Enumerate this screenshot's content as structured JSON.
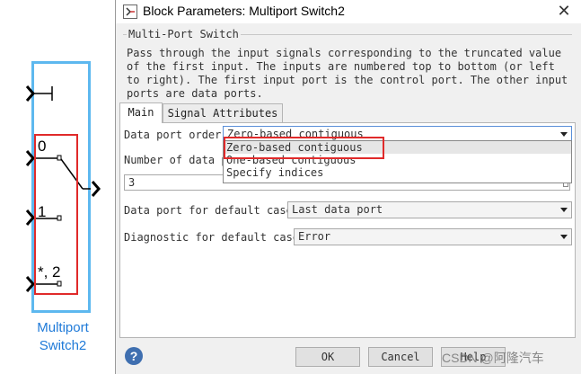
{
  "block": {
    "port_labels": [
      "0",
      "1",
      "*, 2"
    ],
    "caption_line1": "Multiport",
    "caption_line2": "Switch2"
  },
  "dialog": {
    "title": "Block Parameters: Multiport Switch2",
    "group_title": "Multi-Port Switch",
    "description": "Pass through the input signals corresponding to the truncated value of the first input. The inputs are numbered top to bottom (or left to right). The first input port is the control port. The other input ports are data ports.",
    "tabs": [
      "Main",
      "Signal Attributes"
    ],
    "fields": {
      "data_port_order_label": "Data port order:",
      "data_port_order_value": "Zero-based contiguous",
      "data_port_order_options": [
        "Zero-based contiguous",
        "One-based contiguous",
        "Specify indices"
      ],
      "num_ports_label": "Number of data po",
      "num_ports_value": "3",
      "default_case_label": "Data port for default case:",
      "default_case_value": "Last data port",
      "diagnostic_label": "Diagnostic for default case:",
      "diagnostic_value": "Error"
    },
    "buttons": {
      "help": "?",
      "ok": "OK",
      "cancel": "Cancel",
      "help_label": "Help"
    }
  },
  "watermark": "CSDN @阿隆汽车"
}
